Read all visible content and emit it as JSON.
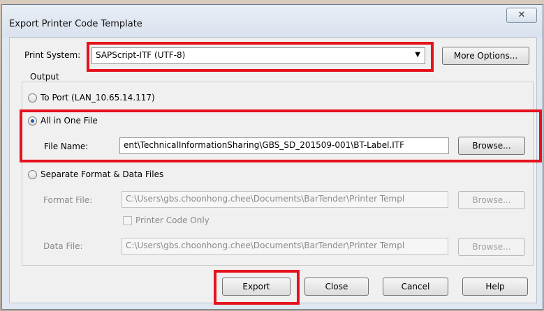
{
  "dialog": {
    "title": "Export Printer Code Template",
    "close_glyph": "✕"
  },
  "print_system": {
    "label": "Print System:",
    "value": "SAPScript-ITF (UTF-8)",
    "more_options": "More Options..."
  },
  "output": {
    "group_label": "Output",
    "to_port_label": "To Port (LAN_10.65.14.117)",
    "all_in_one_label": "All in One File",
    "file_name_label": "File Name:",
    "file_name_value": "ent\\TechnicalInformationSharing\\GBS_SD_201509-001\\BT-Label.ITF",
    "browse": "Browse...",
    "separate_label": "Separate Format & Data Files",
    "format_file_label": "Format File:",
    "format_file_value": "C:\\Users\\gbs.choonhong.chee\\Documents\\BarTender\\Printer Templ",
    "printer_code_only": "Printer Code Only",
    "data_file_label": "Data File:",
    "data_file_value": "C:\\Users\\gbs.choonhong.chee\\Documents\\BarTender\\Printer Templ"
  },
  "buttons": {
    "export": "Export",
    "close": "Close",
    "cancel": "Cancel",
    "help": "Help"
  },
  "colors": {
    "highlight": "#e5121d",
    "selected_radio": "#1f5fae"
  }
}
